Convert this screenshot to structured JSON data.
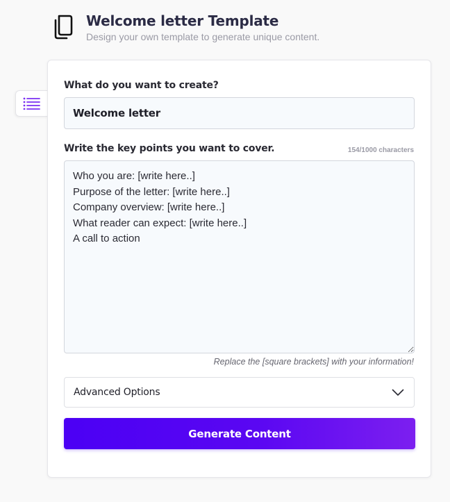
{
  "header": {
    "icon": "copy-icon",
    "title": "Welcome letter Template",
    "subtitle": "Design your own template to generate unique content."
  },
  "sidebar_toggle": {
    "icon": "list-icon",
    "color": "#7b2ff2"
  },
  "form": {
    "topic_label": "What do you want to create?",
    "topic_value": "Welcome letter",
    "points_label": "Write the key points you want to cover.",
    "char_count": "154/1000 characters",
    "points_value": "Who you are: [write here..]\nPurpose of the letter: [write here..]\nCompany overview: [write here..]\nWhat reader can expect: [write here..]\nA call to action",
    "hint": "Replace the [square brackets] with your information!",
    "advanced_label": "Advanced Options",
    "advanced_icon": "chevron-down-icon",
    "generate_label": "Generate Content"
  },
  "colors": {
    "accent_start": "#4b00f4",
    "accent_end": "#7c1ff0",
    "title": "#2b2b45",
    "muted": "#9a9aa5",
    "field_bg": "#f7fafd"
  }
}
